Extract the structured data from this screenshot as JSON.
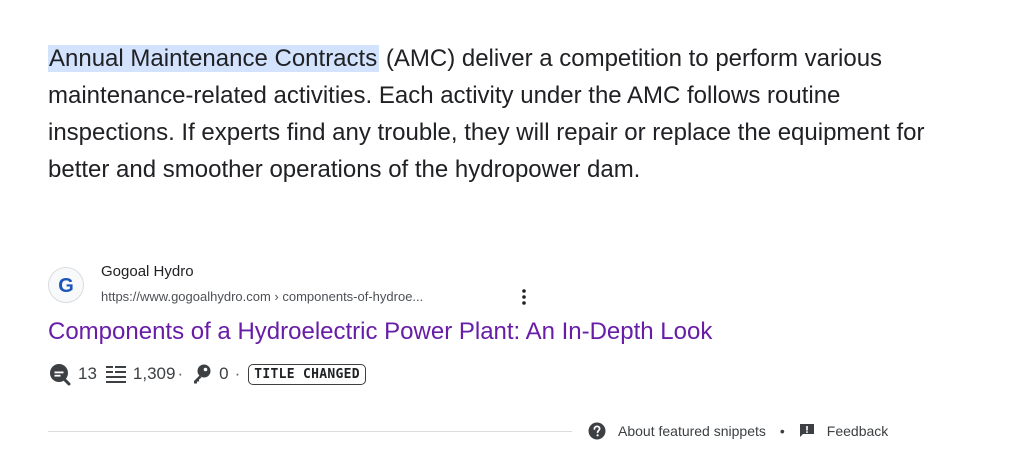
{
  "snippet": {
    "highlight": "Annual Maintenance Contracts",
    "rest": " (AMC) deliver a competition to perform various maintenance-related activities. Each activity under the AMC follows routine inspections. If experts find any trouble, they will repair or replace the equipment for better and smoother operations of the hydropower dam."
  },
  "source": {
    "favicon_letter": "G",
    "site_name": "Gogoal Hydro",
    "url": "https://www.gogoalhydro.com › components-of-hydroe...",
    "more_icon": "three-dots-vertical-icon"
  },
  "result": {
    "title": "Components of a Hydroelectric Power Plant: An In-Depth Look"
  },
  "meta": {
    "comments_icon": "search-bubble-icon",
    "comments": "13",
    "words_icon": "text-lines-icon",
    "words": "1,309",
    "separator": "·",
    "keys_icon": "key-icon",
    "keys": "0",
    "badge": "TITLE CHANGED"
  },
  "footer": {
    "about_icon": "help-circle-icon",
    "about": "About featured snippets",
    "separator": "•",
    "feedback_icon": "feedback-icon",
    "feedback": "Feedback"
  },
  "colors": {
    "highlight_bg": "#d3e3fd",
    "title_link": "#681da8",
    "text": "#202124"
  }
}
